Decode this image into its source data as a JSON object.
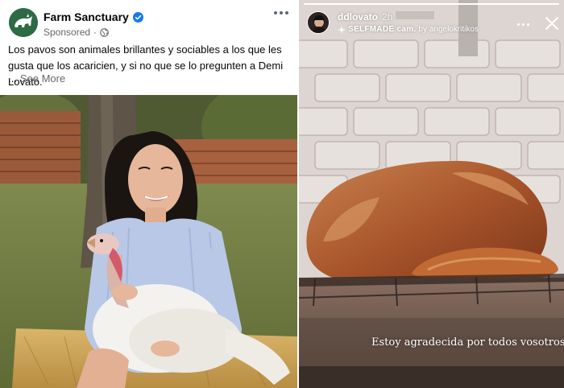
{
  "facebook_post": {
    "page_name": "Farm Sanctuary",
    "verified": true,
    "sponsored_label": "Sponsored",
    "separator": "·",
    "more_icon": "more-horizontal-icon",
    "text": "Los pavos son animales brillantes y sociables a los que les gusta que los acaricien, y si no que se lo pregunten a Demi Lovato.",
    "see_more_prefix": "...",
    "see_more_label": "See More",
    "photo_description_icon": "photo-woman-holding-turkey",
    "colors": {
      "brand": "#2e6b45",
      "verified": "#1877f2",
      "meta_text": "#65676b"
    }
  },
  "instagram_story": {
    "username": "ddlovato",
    "time": "2h",
    "sub_label_bold": "SELFMADE cam.",
    "sub_label_rest": "by angelokritikos",
    "progress": 1.0,
    "caption": "Estoy agradecida por todos vosotros",
    "caption_emoji_icon": "black-heart-icon",
    "colors": {
      "bg_tile": "#d9d2cd",
      "turkey": "#b9673a"
    }
  }
}
